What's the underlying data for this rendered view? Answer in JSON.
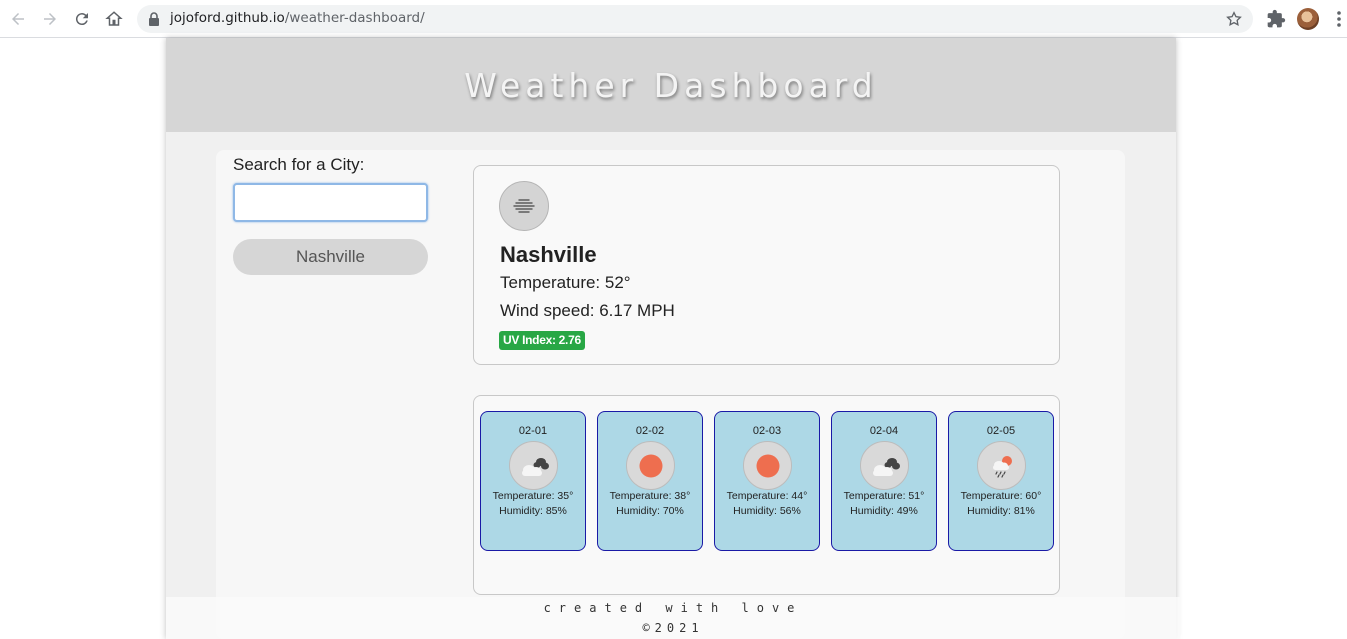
{
  "browser": {
    "url_host": "jojoford.github.io",
    "url_path": "/weather-dashboard/"
  },
  "header": {
    "title": "Weather Dashboard"
  },
  "search": {
    "label": "Search for a City:",
    "value": "",
    "history": [
      "Nashville"
    ]
  },
  "current": {
    "icon": "mist-icon",
    "city": "Nashville",
    "temperature": "Temperature: 52°",
    "wind": "Wind speed: 6.17 MPH",
    "uv": "UV Index: 2.76",
    "uv_color": "#28a745"
  },
  "forecast": [
    {
      "date": "02-01",
      "icon": "cloudy-icon",
      "temperature": "Temperature: 35°",
      "humidity": "Humidity: 85%"
    },
    {
      "date": "02-02",
      "icon": "sun-icon",
      "temperature": "Temperature: 38°",
      "humidity": "Humidity: 70%"
    },
    {
      "date": "02-03",
      "icon": "sun-icon",
      "temperature": "Temperature: 44°",
      "humidity": "Humidity: 56%"
    },
    {
      "date": "02-04",
      "icon": "cloudy-icon",
      "temperature": "Temperature: 51°",
      "humidity": "Humidity: 49%"
    },
    {
      "date": "02-05",
      "icon": "rain-icon",
      "temperature": "Temperature: 60°",
      "humidity": "Humidity: 81%"
    }
  ],
  "footer": {
    "line1": "created with love",
    "line2": "©2021"
  },
  "colors": {
    "card_bg": "#add8e6",
    "card_border": "#1a1aa6",
    "sun": "#ee6e4f"
  }
}
